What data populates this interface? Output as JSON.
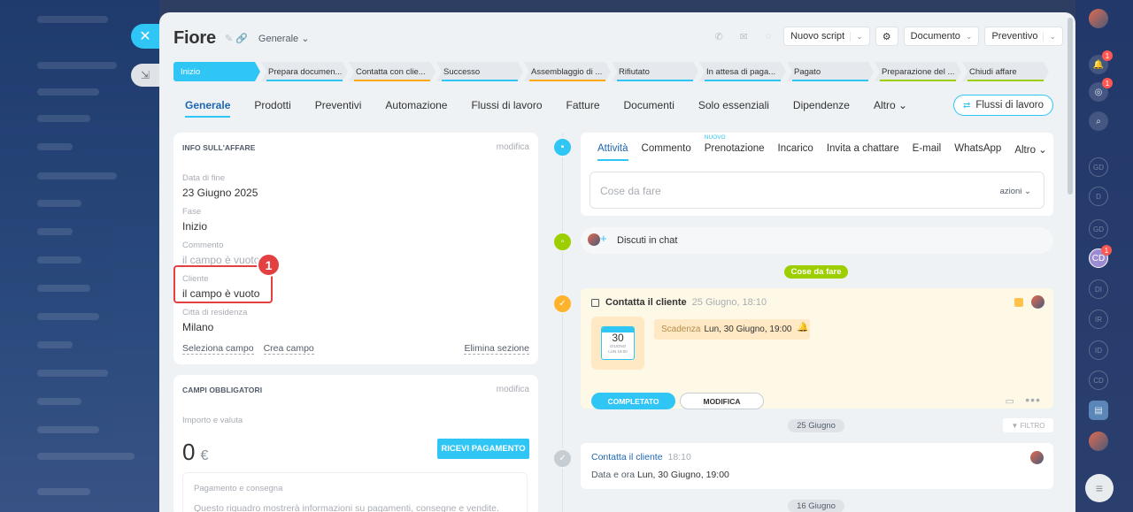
{
  "deal": {
    "title": "Fiore",
    "category": "Generale"
  },
  "header_actions": {
    "new_script": "Nuovo script",
    "document": "Documento",
    "quote": "Preventivo"
  },
  "stages": [
    {
      "label": "Inizio",
      "color": "#2fc6f6"
    },
    {
      "label": "Prepara documen...",
      "color": "#2fc6f6"
    },
    {
      "label": "Contatta con clie...",
      "color": "#ffa900"
    },
    {
      "label": "Successo",
      "color": "#2fc6f6"
    },
    {
      "label": "Assemblaggio di ...",
      "color": "#ffa900"
    },
    {
      "label": "Rifiutato",
      "color": "#2fc6f6"
    },
    {
      "label": "In attesa di paga...",
      "color": "#2fc6f6"
    },
    {
      "label": "Pagato",
      "color": "#2fc6f6"
    },
    {
      "label": "Preparazione del ...",
      "color": "#9dcf00"
    },
    {
      "label": "Chiudi affare",
      "color": "#9dcf00"
    }
  ],
  "tabs": [
    "Generale",
    "Prodotti",
    "Preventivi",
    "Automazione",
    "Flussi di lavoro",
    "Fatture",
    "Documenti",
    "Solo essenziali",
    "Dipendenze",
    "Altro"
  ],
  "flows_button": "Flussi di lavoro",
  "info_panel": {
    "header": "INFO SULL'AFFARE",
    "edit": "modifica",
    "fields": [
      {
        "label": "Data di fine",
        "value": "23 Giugno 2025",
        "empty": false
      },
      {
        "label": "Fase",
        "value": "Inizio",
        "empty": false
      },
      {
        "label": "Commento",
        "value": "il campo è vuoto",
        "empty": true
      },
      {
        "label": "Cliente",
        "value": "il campo è vuoto",
        "empty": false
      },
      {
        "label": "Città di residenza",
        "value": "Milano",
        "empty": false
      }
    ],
    "select_field": "Seleziona campo",
    "create_field": "Crea campo",
    "delete_section": "Elimina sezione"
  },
  "callout_number": "1",
  "required_panel": {
    "header": "CAMPI OBBLIGATORI",
    "edit": "modifica",
    "amount_label": "Importo e valuta",
    "amount": "0",
    "currency": "€",
    "pay_button": "RICEVI PAGAMENTO",
    "payment_title": "Pagamento e consegna",
    "payment_desc": "Questo riquadro mostrerà informazioni su pagamenti, consegne e vendite."
  },
  "activity": {
    "tabs": [
      "Attività",
      "Commento",
      "Prenotazione",
      "Incarico",
      "Invita a chattare",
      "E-mail",
      "WhatsApp",
      "Altro"
    ],
    "new_badge": "NUOVO",
    "placeholder": "Cose da fare",
    "actions": "azioni"
  },
  "chat": {
    "label": "Discuti in chat"
  },
  "todo_pill": "Cose da fare",
  "todo": {
    "title": "Contatta il cliente",
    "time": "25 Giugno, 18:10",
    "calendar_day": "30",
    "calendar_month": "GIUGNO",
    "calendar_sub": "LUN 19:00",
    "deadline_label": "Scadenza",
    "deadline_value": "Lun, 30 Giugno, 19:00",
    "done_button": "COMPLETATO",
    "edit_button": "MODIFICA"
  },
  "date_pill_1": "25 Giugno",
  "filter": "FILTRO",
  "history": {
    "title": "Contatta il cliente",
    "time": "18:10",
    "detail_label": "Data e ora",
    "detail_value": "Lun, 30 Giugno, 19:00"
  },
  "date_pill_2": "16 Giugno",
  "right_bar": {
    "avatars": [
      "GD",
      "D",
      "GD",
      "CD",
      "DI",
      "IR",
      "ID",
      "CD"
    ],
    "badge": "1"
  }
}
